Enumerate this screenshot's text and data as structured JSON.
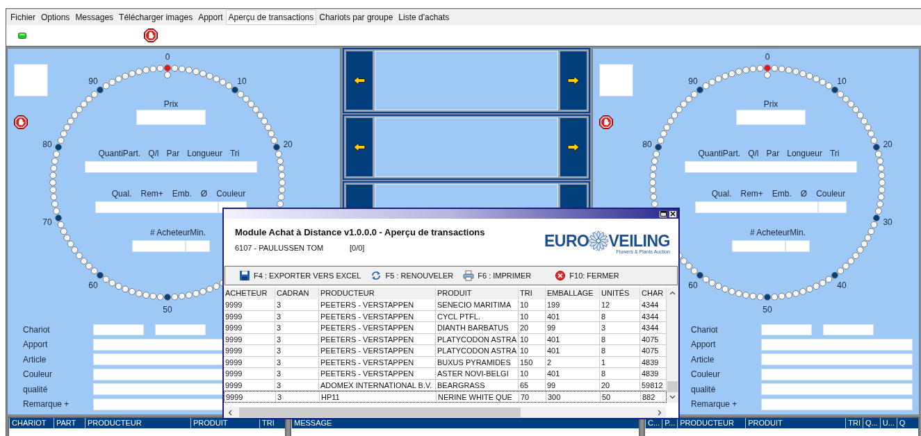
{
  "menu": [
    {
      "label": "Fichier",
      "selected": false
    },
    {
      "label": "Options",
      "selected": false
    },
    {
      "label": "Messages",
      "selected": false
    },
    {
      "label": "Télécharger images",
      "selected": false
    },
    {
      "label": "Apport",
      "selected": false
    },
    {
      "label": "Aperçu de transactions",
      "selected": true
    },
    {
      "label": "Chariots par groupe",
      "selected": false
    },
    {
      "label": "Liste d'achats",
      "selected": false
    }
  ],
  "panels": [
    {
      "dial_labels": [
        "0",
        "10",
        "20",
        "50",
        "60",
        "70",
        "80",
        "90"
      ],
      "price_label": "Prix",
      "row1_labels": [
        "Quanti",
        "Part.",
        "Q/l",
        "Par",
        "Longueur",
        "Tri"
      ],
      "row2_labels": [
        "Qual.",
        "Rem+",
        "Emb.",
        "Ø",
        "Couleur"
      ],
      "row3_labels": [
        "# Acheteur",
        "Min."
      ],
      "form": [
        {
          "label": "Chariot",
          "kind": "pair"
        },
        {
          "label": "Apport",
          "kind": "wide"
        },
        {
          "label": "Article",
          "kind": "wide"
        },
        {
          "label": "Couleur",
          "kind": "wide"
        },
        {
          "label": "qualité",
          "kind": "wide"
        },
        {
          "label": "Remarque +",
          "kind": "wide"
        }
      ]
    },
    {
      "dial_labels": [
        "0",
        "10",
        "20",
        "30",
        "40",
        "50",
        "60",
        "80",
        "90"
      ],
      "price_label": "Prix",
      "row1_labels": [
        "Quanti",
        "Part.",
        "Q/l",
        "Par",
        "Longueur",
        "Tri"
      ],
      "row2_labels": [
        "Qual.",
        "Rem+",
        "Emb.",
        "Ø",
        "Couleur"
      ],
      "row3_labels": [
        "# Acheteur",
        "Min."
      ],
      "form": [
        {
          "label": "Chariot",
          "kind": "pair"
        },
        {
          "label": "Apport",
          "kind": "wide"
        },
        {
          "label": "Article",
          "kind": "wide"
        },
        {
          "label": "Couleur",
          "kind": "wide"
        },
        {
          "label": "qualité",
          "kind": "wide"
        },
        {
          "label": "Remarque +",
          "kind": "wide"
        }
      ]
    }
  ],
  "bottom_tables": [
    {
      "columns": [
        "CHARIOT",
        "PART",
        "PRODUCTEUR",
        "PRODUIT",
        "TRI"
      ]
    },
    {
      "columns": [
        "MESSAGE"
      ]
    },
    {
      "columns": [
        "C...",
        "P...",
        "PRODUCTEUR",
        "PRODUIT",
        "TRI",
        "Q...",
        "U...",
        "Q"
      ]
    }
  ],
  "dialog": {
    "title": "Module Achat à Distance v1.0.0.0 - Aperçu de transactions",
    "user": "6107 - PAULUSSEN TOM",
    "counter": "[0/0]",
    "logo": {
      "word1": "EURO",
      "word2": "VEILING",
      "tagline": "Flowers & Plants Auction"
    },
    "actions": [
      {
        "label": "F4 : EXPORTER VERS EXCEL",
        "kind": "save"
      },
      {
        "label": "F5 : RENOUVELER",
        "kind": "refresh"
      },
      {
        "label": "F6 : IMPRIMER",
        "kind": "print"
      },
      {
        "label": "F10: FERMER",
        "kind": "close"
      }
    ],
    "table": {
      "columns": [
        "ACHETEUR",
        "CADRAN",
        "PRODUCTEUR",
        "PRODUIT",
        "TRI",
        "EMBALLAGE",
        "UNITÉS",
        "CHAR"
      ],
      "rows": [
        {
          "cells": [
            "9999",
            "3",
            "PEETERS - VERSTAPPEN",
            "SENECIO MARITIMA",
            "10",
            "199",
            "12",
            "4344"
          ],
          "selected": false
        },
        {
          "cells": [
            "9999",
            "3",
            "PEETERS - VERSTAPPEN",
            "CYCL PTFL.",
            "10",
            "401",
            "8",
            "4344"
          ],
          "selected": false
        },
        {
          "cells": [
            "9999",
            "3",
            "PEETERS - VERSTAPPEN",
            "DIANTH BARBATUS",
            "20",
            "99",
            "3",
            "4344"
          ],
          "selected": false
        },
        {
          "cells": [
            "9999",
            "3",
            "PEETERS - VERSTAPPEN",
            "PLATYCODON ASTRA",
            "10",
            "401",
            "8",
            "4075"
          ],
          "selected": false
        },
        {
          "cells": [
            "9999",
            "3",
            "PEETERS - VERSTAPPEN",
            "PLATYCODON ASTRA",
            "10",
            "401",
            "8",
            "4075"
          ],
          "selected": false
        },
        {
          "cells": [
            "9999",
            "3",
            "PEETERS - VERSTAPPEN",
            "BUXUS PYRAMIDES",
            "150",
            "2",
            "1",
            "4839"
          ],
          "selected": false
        },
        {
          "cells": [
            "9999",
            "3",
            "PEETERS - VERSTAPPEN",
            "ASTER NOVI-BELGI",
            "10",
            "401",
            "8",
            "4839"
          ],
          "selected": false
        },
        {
          "cells": [
            "9999",
            "3",
            "ADOMEX INTERNATIONAL B.V.",
            "BEARGRASS",
            "65",
            "99",
            "20",
            "59812"
          ],
          "selected": false
        },
        {
          "cells": [
            "9999",
            "3",
            "HP11",
            "NERINE WHITE QUE",
            "70",
            "300",
            "50",
            "882"
          ],
          "selected": true
        }
      ]
    }
  }
}
